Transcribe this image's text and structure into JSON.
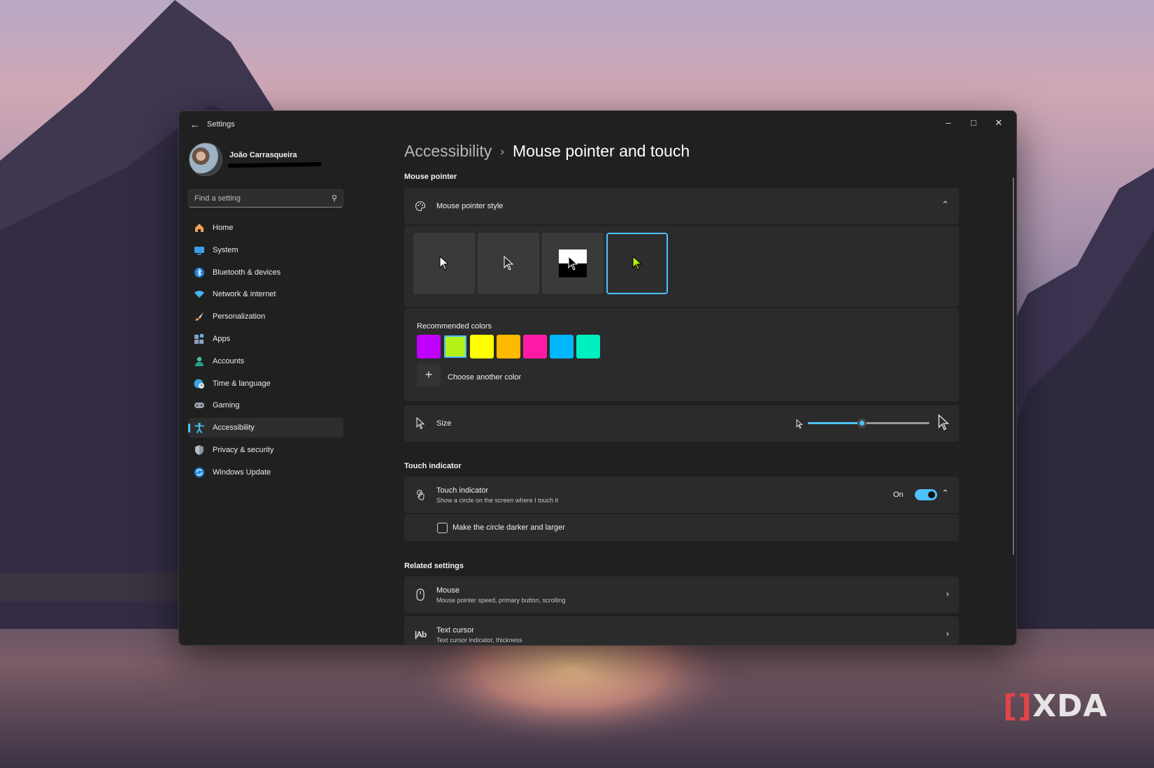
{
  "window": {
    "title": "Settings"
  },
  "profile": {
    "name": "João Carrasqueira"
  },
  "search": {
    "placeholder": "Find a setting"
  },
  "sidebar": {
    "items": [
      {
        "label": "Home",
        "icon": "home-icon"
      },
      {
        "label": "System",
        "icon": "system-icon"
      },
      {
        "label": "Bluetooth & devices",
        "icon": "bluetooth-icon"
      },
      {
        "label": "Network & internet",
        "icon": "wifi-icon"
      },
      {
        "label": "Personalization",
        "icon": "brush-icon"
      },
      {
        "label": "Apps",
        "icon": "apps-icon"
      },
      {
        "label": "Accounts",
        "icon": "accounts-icon"
      },
      {
        "label": "Time & language",
        "icon": "globe-clock-icon"
      },
      {
        "label": "Gaming",
        "icon": "gamepad-icon"
      },
      {
        "label": "Accessibility",
        "icon": "accessibility-icon",
        "active": true
      },
      {
        "label": "Privacy & security",
        "icon": "shield-icon"
      },
      {
        "label": "Windows Update",
        "icon": "update-icon"
      }
    ]
  },
  "breadcrumb": {
    "parent": "Accessibility",
    "current": "Mouse pointer and touch"
  },
  "mouse_pointer": {
    "section_title": "Mouse pointer",
    "style_label": "Mouse pointer style",
    "styles": [
      "white",
      "black",
      "inverted",
      "custom"
    ],
    "selected_style": "custom",
    "recommended_label": "Recommended colors",
    "colors": [
      "#bf00ff",
      "#b5f219",
      "#ffff00",
      "#ffb900",
      "#ff1aa5",
      "#00b7ff",
      "#00f0bf"
    ],
    "selected_color": "#b5f219",
    "choose_color_label": "Choose another color",
    "size_label": "Size",
    "size_fraction": 0.44
  },
  "touch_indicator": {
    "section_title": "Touch indicator",
    "title": "Touch indicator",
    "subtitle": "Show a circle on the screen where I touch it",
    "state_label": "On",
    "enabled": true,
    "option_label": "Make the circle darker and larger",
    "option_checked": false
  },
  "related": {
    "section_title": "Related settings",
    "items": [
      {
        "title": "Mouse",
        "subtitle": "Mouse pointer speed, primary button, scrolling",
        "icon": "mouse-icon"
      },
      {
        "title": "Text cursor",
        "subtitle": "Text cursor indicator, thickness",
        "icon": "text-cursor-icon"
      }
    ]
  },
  "watermark": {
    "text": "XDA"
  },
  "colors": {
    "accent": "#4cc2ff",
    "window_bg": "#202020",
    "card_bg": "#2b2b2b"
  }
}
